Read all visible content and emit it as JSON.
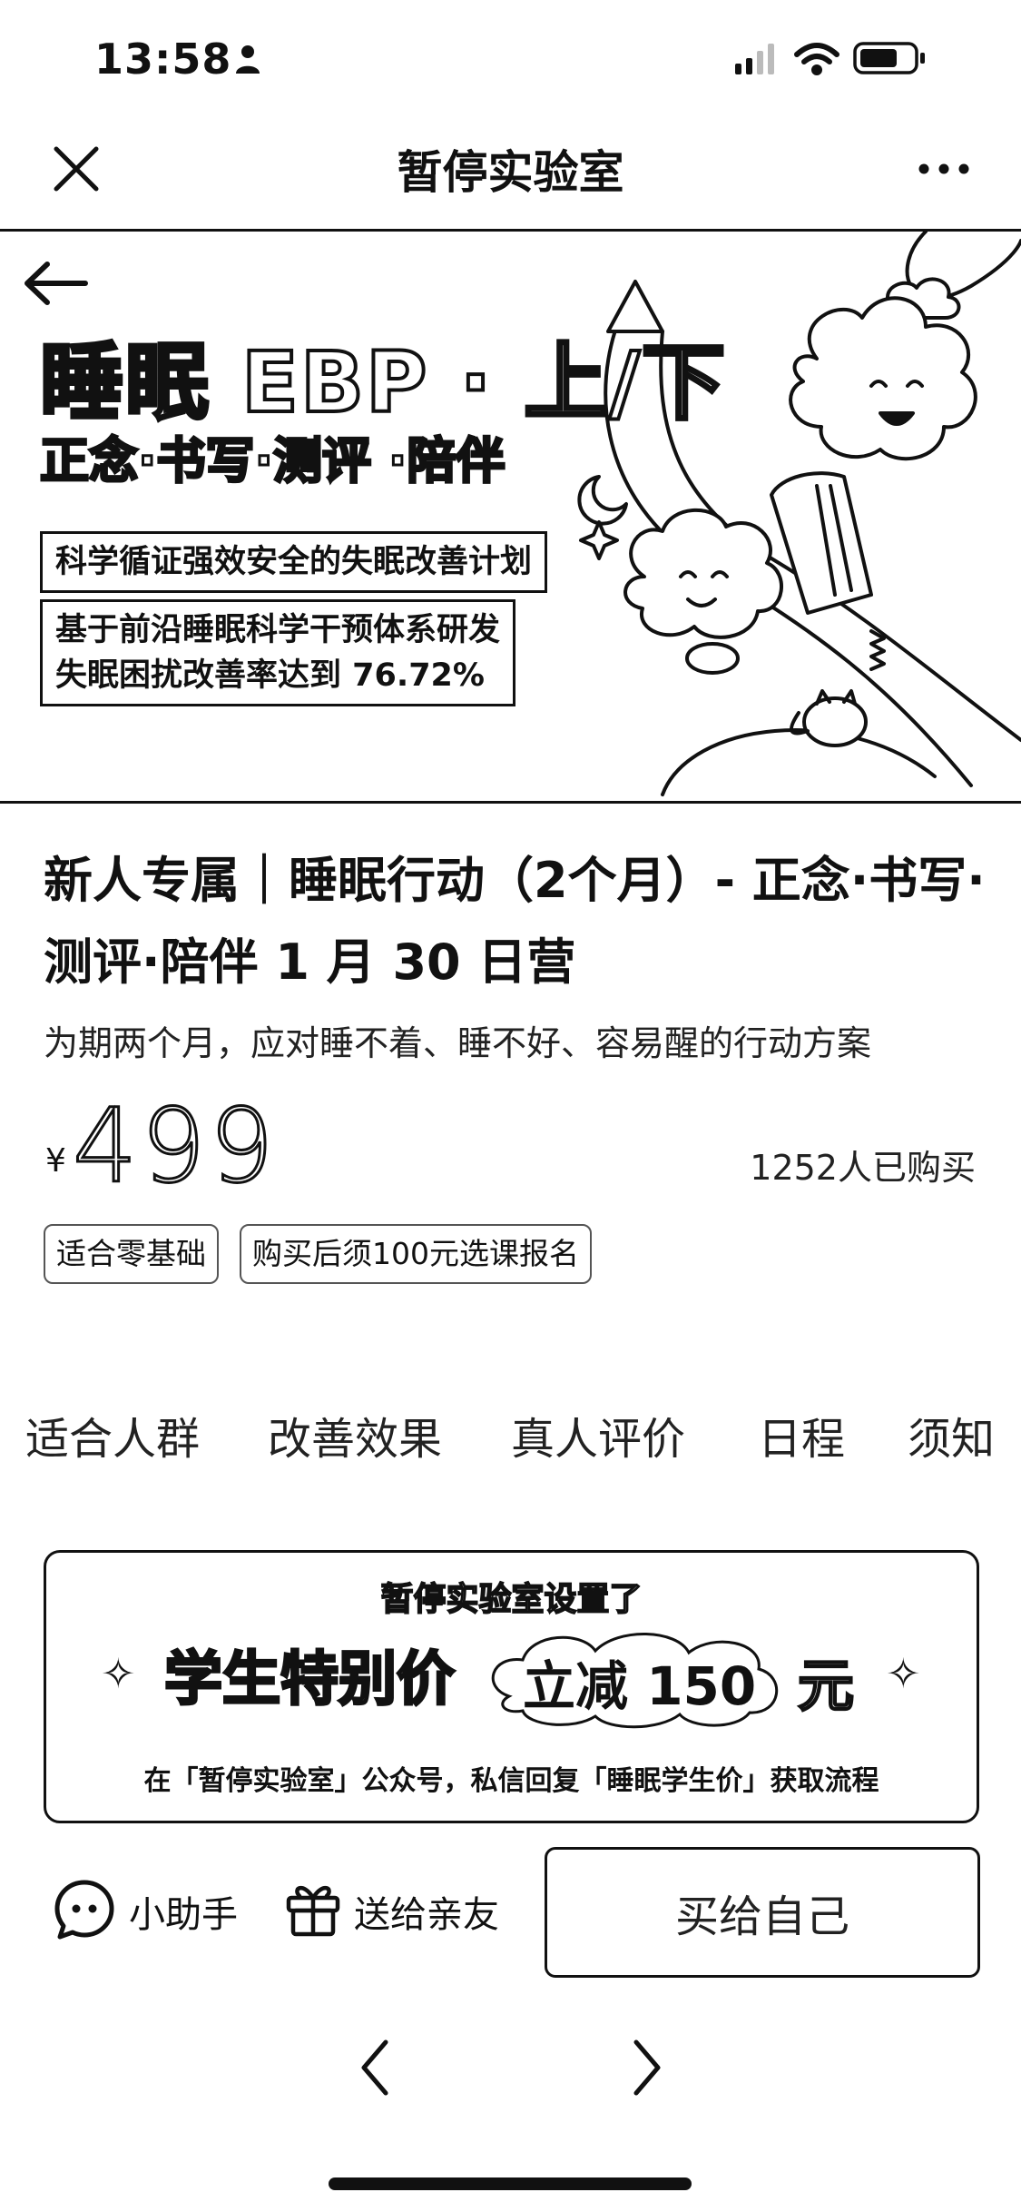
{
  "status_bar": {
    "time": "13:58"
  },
  "nav": {
    "title": "暂停实验室"
  },
  "banner": {
    "title": "睡眠 EBP · 上/下",
    "subtitle": "正念·书写·测评 ·陪伴",
    "line1": "科学循证强效安全的失眠改善计划",
    "line2": "基于前沿睡眠科学干预体系研发",
    "line3": "失眠困扰改善率达到 76.72%"
  },
  "product": {
    "title": "新人专属｜睡眠行动（2个月）- 正念·书写·测评·陪伴 1 月 30 日营",
    "description": "为期两个月，应对睡不着、睡不好、容易醒的行动方案",
    "currency": "¥",
    "price": "499",
    "sold_count": "1252人已购买",
    "tags": [
      "适合零基础",
      "购买后须100元选课报名"
    ]
  },
  "tabs": [
    "适合人群",
    "改善效果",
    "真人评价",
    "日程",
    "须知"
  ],
  "promo": {
    "header": "暂停实验室设置了",
    "title": "学生特别价",
    "reduce": "立减 150",
    "unit": "元",
    "note": "在「暂停实验室」公众号，私信回复「睡眠学生价」获取流程"
  },
  "bottom_bar": {
    "assistant_label": "小助手",
    "gift_label": "送给亲友",
    "buy_label": "买给自己"
  }
}
